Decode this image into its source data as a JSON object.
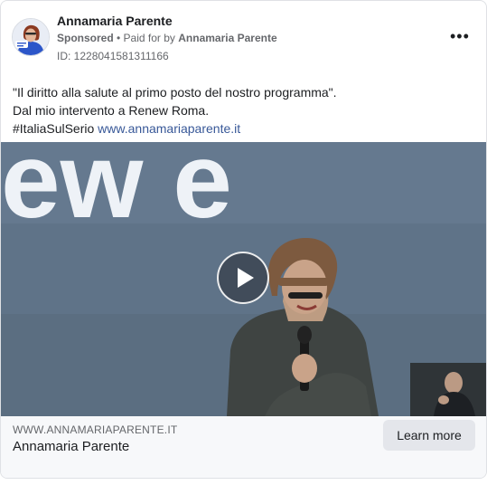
{
  "post": {
    "page_name": "Annamaria Parente",
    "sponsored_label": "Sponsored",
    "paid_for_prefix": " • Paid for by ",
    "paid_for_name": "Annamaria Parente",
    "ad_id": "ID: 1228041581311166",
    "body_lines": [
      "\"Il diritto alla salute al primo posto del nostro programma\".",
      "Dal mio intervento a Renew Roma."
    ],
    "hashtag": "#ItaliaSulSerio",
    "body_link": "www.annamariaparente.it"
  },
  "media": {
    "backdrop_text": "ew e",
    "type": "video"
  },
  "footer": {
    "domain": "WWW.ANNAMARIAPARENTE.IT",
    "title": "Annamaria Parente",
    "cta_label": "Learn more"
  },
  "icons": {
    "more": "more-options-icon",
    "play": "play-icon",
    "avatar": "profile-avatar"
  },
  "colors": {
    "link": "#385898",
    "muted_text": "#65676b",
    "button_bg": "#e4e6eb",
    "media_bg": "#5d7086"
  }
}
